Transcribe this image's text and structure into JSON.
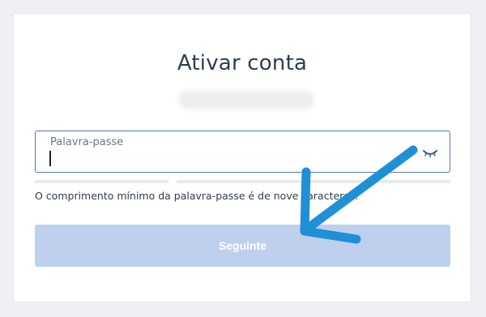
{
  "page": {
    "title": "Ativar conta",
    "password_field": {
      "label": "Palavra-passe",
      "value": "",
      "placeholder": ""
    },
    "visibility_toggle_icon": "eye-closed-icon",
    "hint": "O comprimento mínimo da palavra-passe é de nove caracteres.",
    "next_button": "Seguinte"
  },
  "colors": {
    "title": "#2f3d4e",
    "input_border": "#5c79a6",
    "button_disabled": "#bfd0ee",
    "annotation_arrow": "#1f8fd6"
  }
}
